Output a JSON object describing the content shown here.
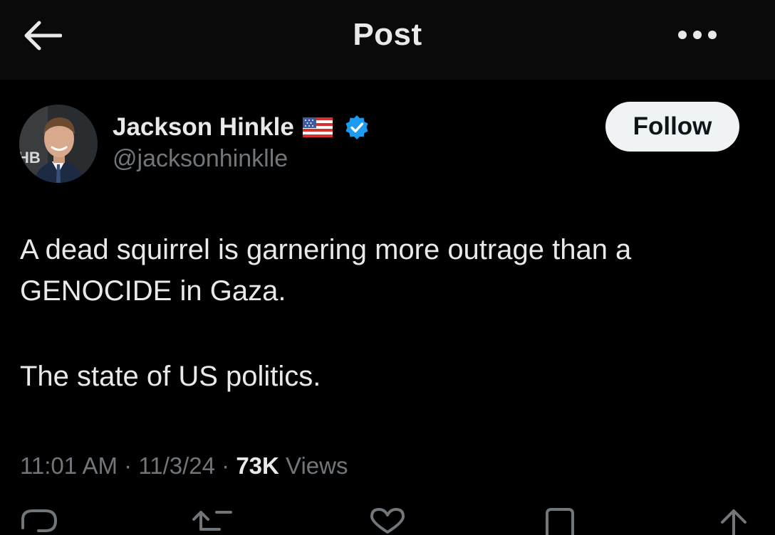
{
  "header": {
    "title": "Post",
    "back_icon": "arrow-left-icon",
    "more_icon": "more-horizontal-icon"
  },
  "author": {
    "display_name": "Jackson Hinkle",
    "handle": "@jacksonhinklle",
    "flag_icon": "us-flag-icon",
    "verified_icon": "verified-badge-icon",
    "verified_color": "#1d9bf0"
  },
  "follow_button": {
    "label": "Follow"
  },
  "tweet": {
    "paragraphs": [
      "A dead squirrel is garnering more outrage than a GENOCIDE in Gaza.",
      "The state of US politics."
    ],
    "time": "11:01 AM",
    "date": "11/3/24",
    "separator": "·",
    "views_count": "73K",
    "views_label": "Views"
  },
  "colors": {
    "background": "#000000",
    "header_background": "#0a0a0a",
    "text_primary": "#e7e9ea",
    "text_secondary": "#71767b",
    "follow_button_bg": "#eff3f4"
  }
}
